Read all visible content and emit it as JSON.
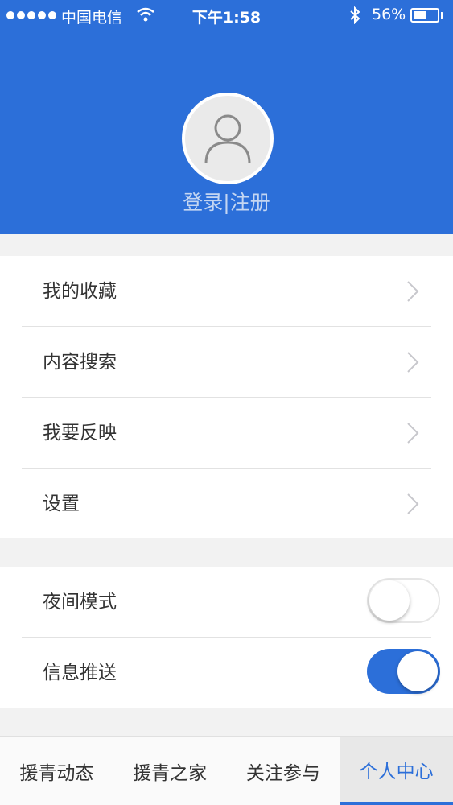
{
  "status_bar": {
    "carrier": "中国电信",
    "time": "下午1:58",
    "battery_percent": "56%",
    "battery_level": 0.56
  },
  "profile": {
    "login_text": "登录|注册"
  },
  "menu": {
    "items": [
      {
        "label": "我的收藏"
      },
      {
        "label": "内容搜索"
      },
      {
        "label": "我要反映"
      },
      {
        "label": "设置"
      }
    ]
  },
  "settings": {
    "night_mode": {
      "label": "夜间模式",
      "enabled": false
    },
    "push": {
      "label": "信息推送",
      "enabled": true
    }
  },
  "tabs": [
    {
      "label": "援青动态",
      "active": false
    },
    {
      "label": "援青之家",
      "active": false
    },
    {
      "label": "关注参与",
      "active": false
    },
    {
      "label": "个人中心",
      "active": true
    }
  ],
  "colors": {
    "brand_blue": "#2c6fd9",
    "page_background": "#f2f2f2"
  }
}
